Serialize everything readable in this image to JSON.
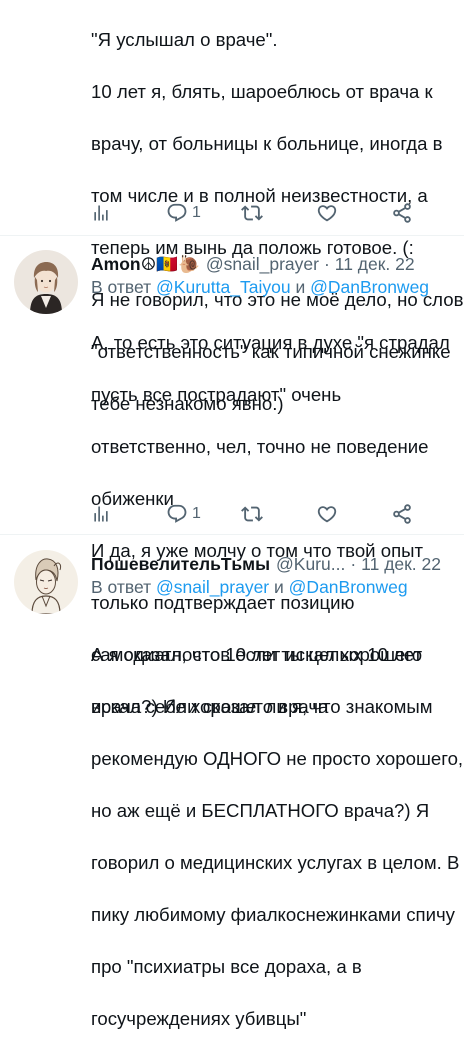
{
  "tweet1": {
    "text_lines": [
      "\"Я услышал о враче\".",
      "10 лет я, блять, шароеблюсь от врача к",
      "врачу, от больницы к больнице, иногда в",
      "том числе и в полной неизвестности, а",
      "теперь им вынь да положь готовое. (:",
      "Я не говорил, что это не моё дело, но слово",
      "\"ответственность\" как типичной снежинке",
      "тебе незнакомо явно.)"
    ],
    "reply_count": "1"
  },
  "tweet2": {
    "display_name": "Amon☮🇲🇩🐌",
    "handle": "@snail_prayer",
    "separator": "·",
    "date": "11 дек. 22",
    "reply_prefix": "В ответ",
    "reply_mention1": "@Kurutta_Taiyou",
    "reply_and": "и",
    "reply_mention2": "@DanBronweg",
    "text_lines": [
      "А, то есть это ситуация в духе \"я страдал",
      "пусть все пострадают\" очень",
      "ответственно, чел, точно не поведение",
      "обиженки",
      "И да, я уже молчу о том что твой опыт",
      "только подтверждает позицию",
      "самодиагностов если ты целых 10 лет",
      "искал себе хорошего врача"
    ],
    "reply_count": "1"
  },
  "tweet3": {
    "display_name": "ПошевелительТьмы",
    "handle": "@Kuru...",
    "separator": "·",
    "date": "11 дек. 22",
    "reply_prefix": "В ответ",
    "reply_mention1": "@snail_prayer",
    "reply_and": "и",
    "reply_mention2": "@DanBronweg",
    "text_lines": [
      "А я сказал, что 10 лет искал хорошего",
      "врача?) Или сказал ли я, что знакомым",
      "рекомендую ОДНОГО не просто хорошего,",
      "но аж ещё и БЕСПЛАТНОГО врача?) Я",
      "говорил о медицинских услугах в целом. В",
      "пику любимому фиалкоснежинками спичу",
      "про \"психиатры все дораха, а в",
      "госучреждениях убивцы\""
    ]
  },
  "colors": {
    "text": "#0f1419",
    "secondary": "#536471",
    "link": "#1d9bf0",
    "divider": "#eff3f4"
  },
  "icons": [
    "views-icon",
    "reply-icon",
    "retweet-icon",
    "like-icon",
    "share-icon"
  ]
}
